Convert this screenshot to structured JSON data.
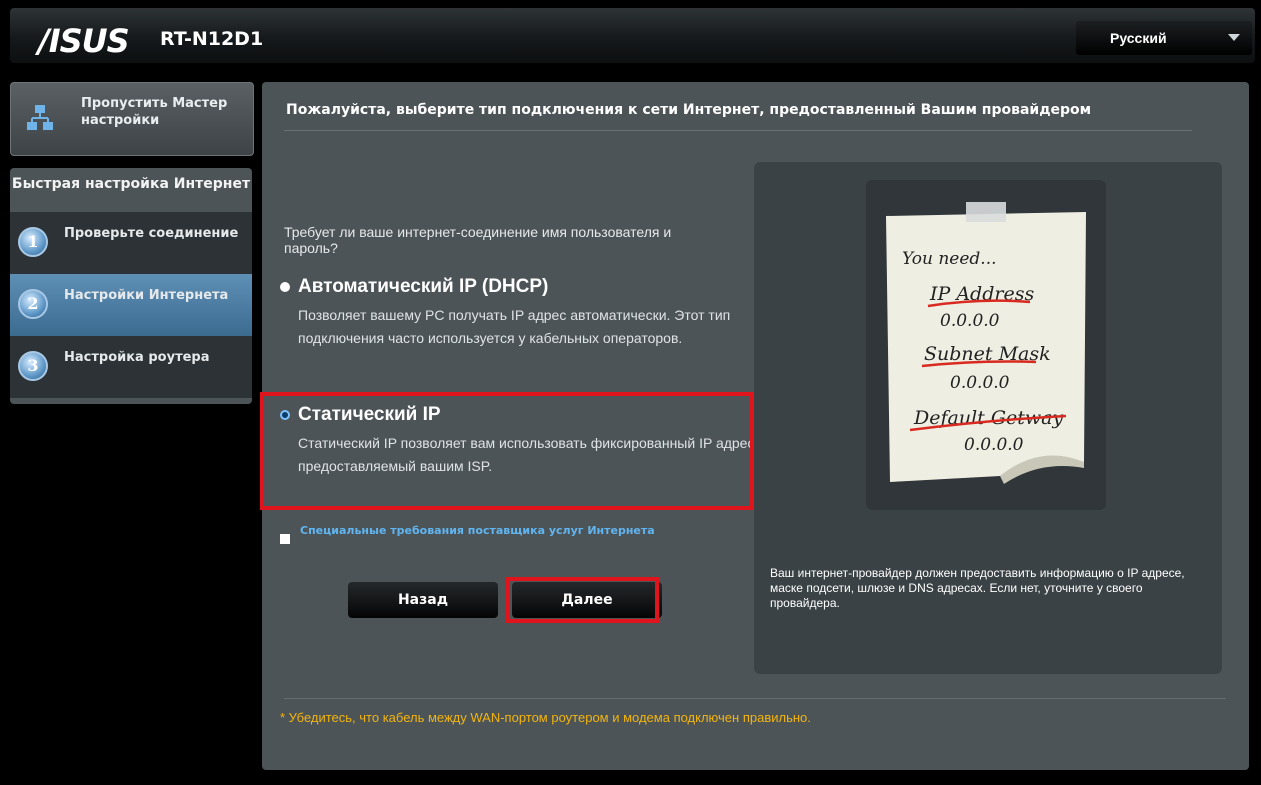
{
  "header": {
    "brand": "/ISUS",
    "model": "RT-N12D1",
    "language": "Русский"
  },
  "sidebar": {
    "skip": "Пропустить Мастер настройки",
    "section_title": "Быстрая настройка Интернет",
    "steps": [
      {
        "num": "1",
        "label": "Проверьте соединение"
      },
      {
        "num": "2",
        "label": "Настройки Интернета"
      },
      {
        "num": "3",
        "label": "Настройка роутера"
      }
    ]
  },
  "main": {
    "heading": "Пожалуйста, выберите тип подключения к сети Интернет, предоставленный Вашим провайдером",
    "question": "Требует ли ваше интернет-соединение имя пользователя и пароль?",
    "options": [
      {
        "title": "Автоматический IP (DHCP)",
        "description": "Позволяет вашему PC получать IP адрес автоматически. Этот тип подключения часто используется у кабельных операторов."
      },
      {
        "title": "Статический IP",
        "description": "Статический IP позволяет вам использовать фиксированный IP адрес, предоставляемый вашим ISP."
      }
    ],
    "special_requirements": "Специальные требования поставщика услуг Интернета",
    "back_button": "Назад",
    "next_button": "Далее",
    "note": {
      "lines": [
        "You need...",
        "IP Address",
        "0.0.0.0",
        "Subnet Mask",
        "0.0.0.0",
        "Default Getway",
        "0.0.0.0"
      ]
    },
    "info": "Ваш интернет-провайдер должен предоставить информацию о IP адресе, маске подсети, шлюзе и DNS адресах. Если нет, уточните у своего провайдера.",
    "footnote": "* Убедитесь, что кабель между WAN-портом роутером и модема подключен правильно."
  },
  "colors": {
    "accent_blue": "#60b5f0",
    "highlight_red": "#e0141d",
    "warning_yellow": "#f2b40f"
  }
}
